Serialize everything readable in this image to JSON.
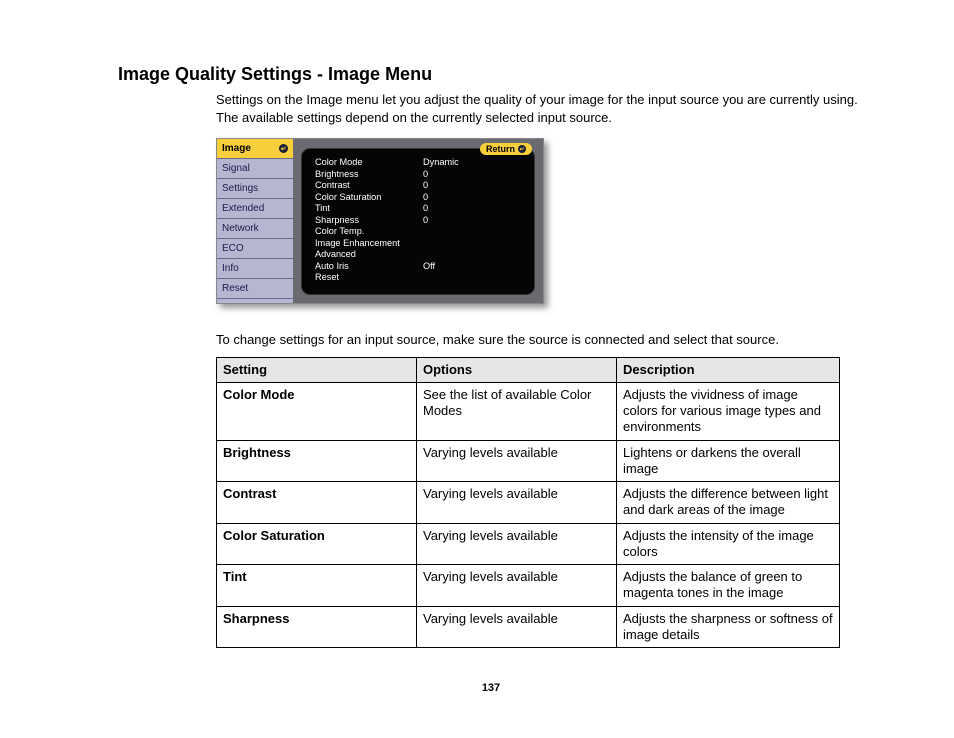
{
  "title": "Image Quality Settings - Image Menu",
  "intro": "Settings on the Image menu let you adjust the quality of your image for the input source you are currently using. The available settings depend on the currently selected input source.",
  "osd": {
    "return_label": "Return",
    "sidebar": [
      {
        "label": "Image",
        "selected": true
      },
      {
        "label": "Signal",
        "selected": false
      },
      {
        "label": "Settings",
        "selected": false
      },
      {
        "label": "Extended",
        "selected": false
      },
      {
        "label": "Network",
        "selected": false
      },
      {
        "label": "ECO",
        "selected": false
      },
      {
        "label": "Info",
        "selected": false
      },
      {
        "label": "Reset",
        "selected": false
      }
    ],
    "rows": [
      {
        "k": "Color Mode",
        "v": "Dynamic"
      },
      {
        "k": "Brightness",
        "v": "0"
      },
      {
        "k": "Contrast",
        "v": "0"
      },
      {
        "k": "Color Saturation",
        "v": "0"
      },
      {
        "k": "Tint",
        "v": "0"
      },
      {
        "k": "Sharpness",
        "v": "0"
      },
      {
        "k": "Color Temp.",
        "v": ""
      },
      {
        "k": "Image Enhancement",
        "v": ""
      },
      {
        "k": "Advanced",
        "v": ""
      },
      {
        "k": "Auto Iris",
        "v": "Off"
      },
      {
        "k": "Reset",
        "v": ""
      }
    ]
  },
  "note2": "To change settings for an input source, make sure the source is connected and select that source.",
  "table": {
    "headers": [
      "Setting",
      "Options",
      "Description"
    ],
    "rows": [
      {
        "setting": "Color Mode",
        "options": "See the list of available Color Modes",
        "desc": "Adjusts the vividness of image colors for various image types and environments"
      },
      {
        "setting": "Brightness",
        "options": "Varying levels available",
        "desc": "Lightens or darkens the overall image"
      },
      {
        "setting": "Contrast",
        "options": "Varying levels available",
        "desc": "Adjusts the difference between light and dark areas of the image"
      },
      {
        "setting": "Color Saturation",
        "options": "Varying levels available",
        "desc": "Adjusts the intensity of the image colors"
      },
      {
        "setting": "Tint",
        "options": "Varying levels available",
        "desc": "Adjusts the balance of green to magenta tones in the image"
      },
      {
        "setting": "Sharpness",
        "options": "Varying levels available",
        "desc": "Adjusts the sharpness or softness of image details"
      }
    ]
  },
  "page_number": "137"
}
